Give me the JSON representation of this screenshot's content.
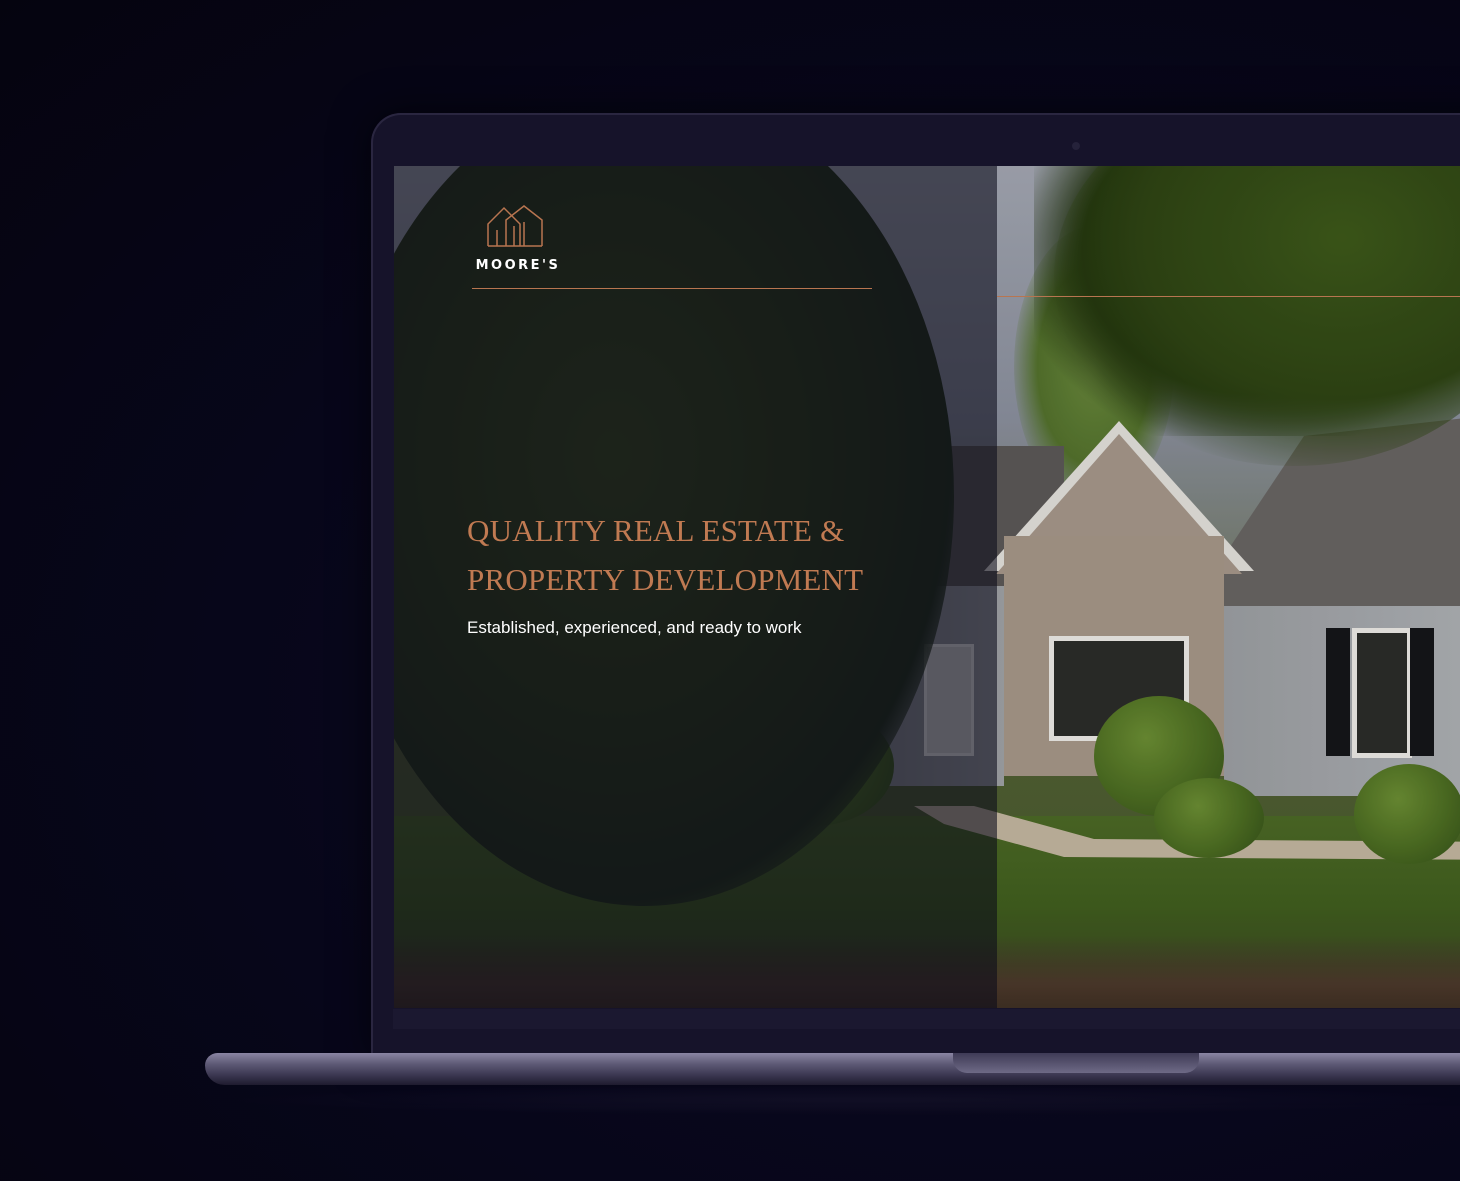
{
  "brand": {
    "name": "MOORE'S",
    "logo_icon": "house-outline-icon",
    "accent_color": "#b87550"
  },
  "hero": {
    "title_line1": "QUALITY REAL ESTATE &",
    "title_line2": "PROPERTY DEVELOPMENT",
    "subtitle": "Established, experienced, and ready to work",
    "title_color": "#c07a52",
    "subtitle_color": "#ffffff"
  },
  "device": {
    "type": "laptop",
    "background_color": "#07061a"
  }
}
